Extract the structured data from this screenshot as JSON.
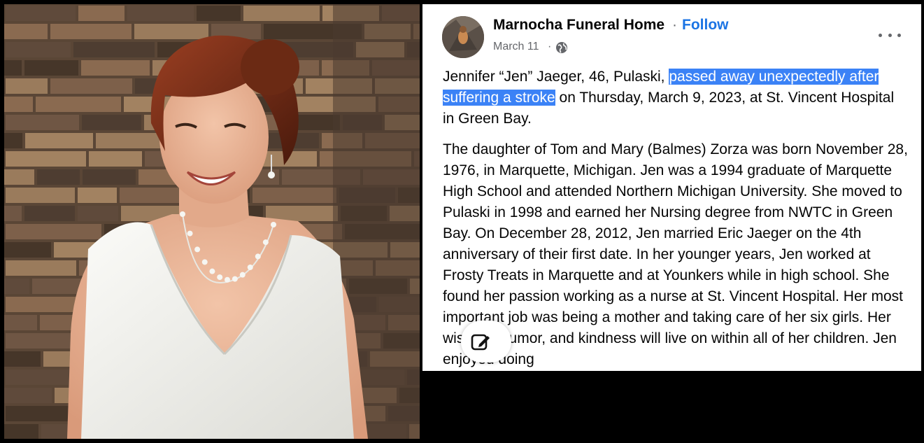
{
  "post": {
    "page_name": "Marnocha Funeral Home",
    "separator": "·",
    "follow_label": "Follow",
    "date": "March 11",
    "date_separator": "·",
    "privacy_icon": "globe-icon",
    "more_icon": "more-options-icon",
    "paragraph1": {
      "before": "Jennifer “Jen” Jaeger, 46, Pulaski, ",
      "highlight_line1": "passed away unexpectedly after",
      "highlight_line2": "suffering a stroke",
      "after": " on Thursday, March 9, 2023, at St. Vincent Hospital in Green Bay."
    },
    "paragraph2": "The daughter of Tom and Mary (Balmes) Zorza was born November 28, 1976, in Marquette, Michigan. Jen was a 1994 graduate of Marquette High School and attended Northern Michigan University. She moved to Pulaski in 1998 and earned her Nursing degree from NWTC in Green Bay. On December 28, 2012, Jen married Eric Jaeger on the 4th anniversary of their first date. In her younger years, Jen worked at Frosty Treats in Marquette and at Younkers while in high school. She found her passion working as a nurse at St. Vincent Hospital. Her most important job was being a mother and taking care of her six girls. Her wisdom, humor, and kindness will live on within all of her children. Jen enjoyed doing",
    "edit_icon": "edit-icon"
  },
  "colors": {
    "link_blue": "#1b74e4",
    "selection_blue": "#3b82f6",
    "secondary_text": "#65676b"
  }
}
